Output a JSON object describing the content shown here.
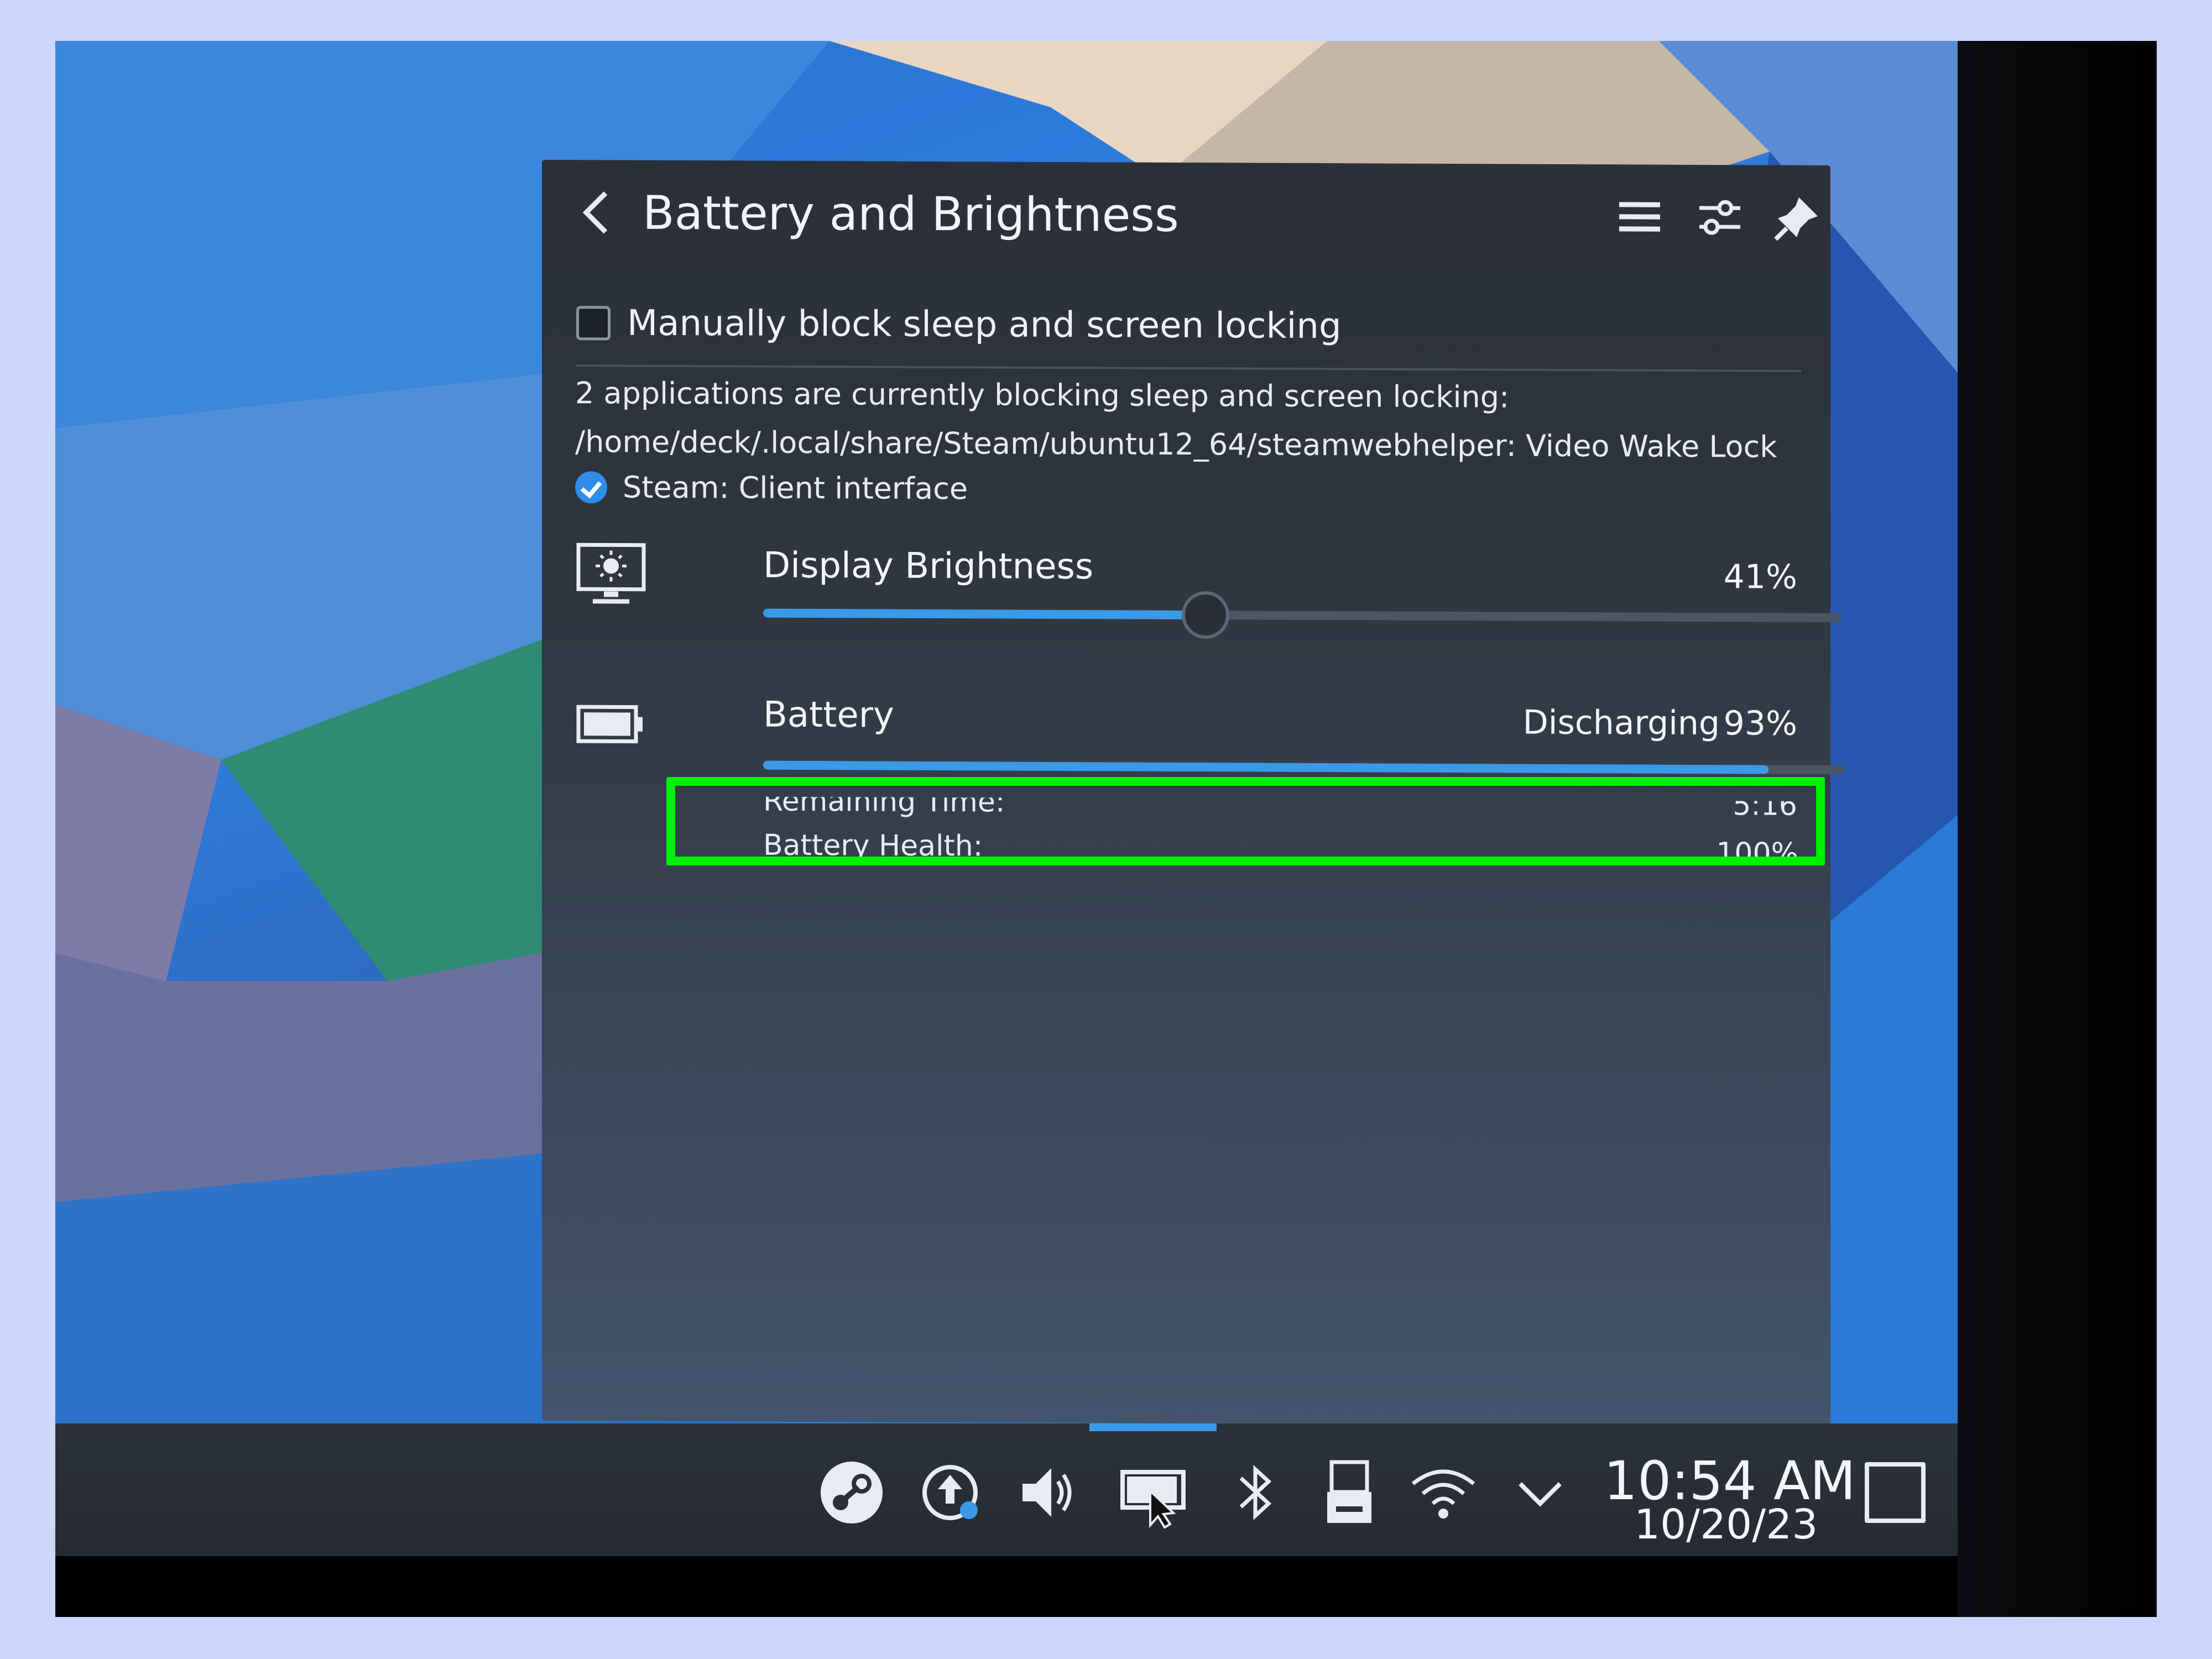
{
  "panel": {
    "title": "Battery and Brightness",
    "back_icon": "chevron-left-icon",
    "header_icons": [
      "hamburger-menu-icon",
      "configure-icon",
      "pin-icon"
    ]
  },
  "sleep": {
    "checkbox_label": "Manually block sleep and screen locking",
    "checked": false,
    "blocking_summary": "2 applications are currently blocking sleep and screen locking:",
    "blocker_1": "/home/deck/.local/share/Steam/ubuntu12_64/steamwebhelper: Video Wake Lock",
    "blocker_2": "Steam: Client interface"
  },
  "brightness": {
    "label": "Display Brightness",
    "value_text": "41%",
    "level": 0.41
  },
  "battery": {
    "label": "Battery",
    "status": "Discharging",
    "percent_text": "93%",
    "level": 0.93,
    "remaining_label": "Remaining Time:",
    "remaining_value": "5:16",
    "health_label": "Battery Health:",
    "health_value": "100%"
  },
  "taskbar": {
    "tray_icons": [
      "steam-icon",
      "update-icon",
      "volume-icon",
      "battery-brightness-icon",
      "bluetooth-icon",
      "storage-icon",
      "wifi-icon",
      "expand-tray-icon"
    ],
    "time": "10:54 AM",
    "date": "10/20/23"
  },
  "colors": {
    "accent": "#3b9ae8",
    "highlight": "#00f000",
    "panel_bg": "#2f3640"
  }
}
